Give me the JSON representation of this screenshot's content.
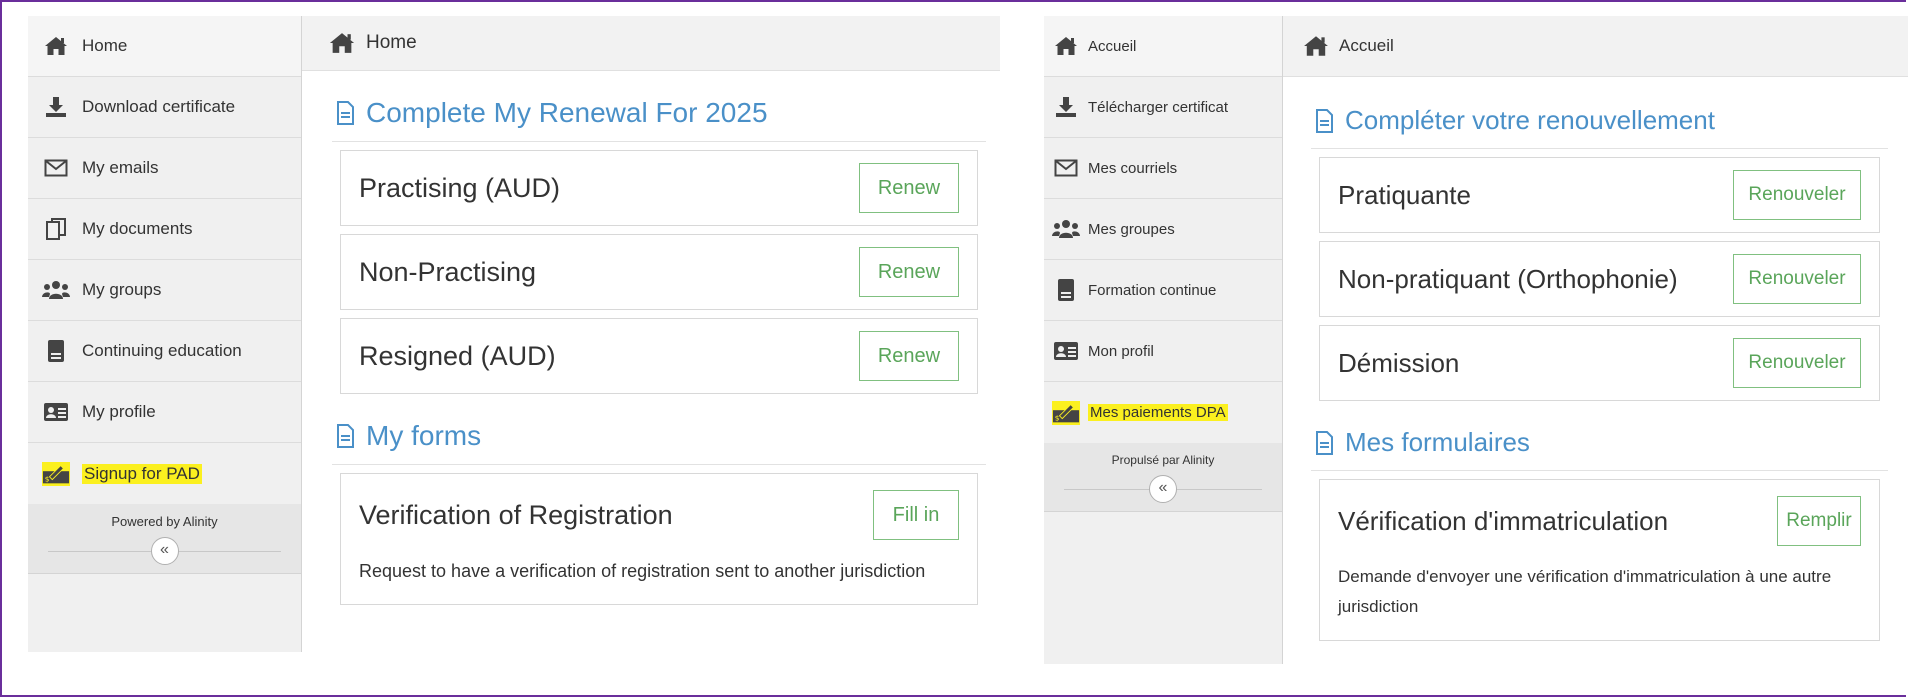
{
  "en": {
    "sidebar": {
      "items": [
        {
          "label": "Home",
          "icon": "home-icon"
        },
        {
          "label": "Download certificate",
          "icon": "download-icon"
        },
        {
          "label": "My emails",
          "icon": "envelope-icon"
        },
        {
          "label": "My documents",
          "icon": "documents-icon"
        },
        {
          "label": "My groups",
          "icon": "groups-icon"
        },
        {
          "label": "Continuing education",
          "icon": "book-icon"
        },
        {
          "label": "My profile",
          "icon": "id-card-icon"
        },
        {
          "label": "Signup for PAD",
          "icon": "check-payment-icon"
        }
      ],
      "powered_by": "Powered by Alinity",
      "collapse_glyph": "«"
    },
    "topbar": {
      "label": "Home"
    },
    "renewal": {
      "title": "Complete My Renewal For 2025",
      "options": [
        {
          "label": "Practising (AUD)",
          "button": "Renew"
        },
        {
          "label": "Non-Practising",
          "button": "Renew"
        },
        {
          "label": "Resigned (AUD)",
          "button": "Renew"
        }
      ]
    },
    "forms": {
      "title": "My forms",
      "items": [
        {
          "label": "Verification of Registration",
          "button": "Fill in",
          "description": "Request to have a verification of registration sent to another jurisdiction"
        }
      ]
    }
  },
  "fr": {
    "sidebar": {
      "items": [
        {
          "label": "Accueil",
          "icon": "home-icon"
        },
        {
          "label": "Télécharger certificat",
          "icon": "download-icon"
        },
        {
          "label": "Mes courriels",
          "icon": "envelope-icon"
        },
        {
          "label": "Mes groupes",
          "icon": "groups-icon"
        },
        {
          "label": "Formation continue",
          "icon": "book-icon"
        },
        {
          "label": "Mon profil",
          "icon": "id-card-icon"
        },
        {
          "label": "Mes paiements DPA",
          "icon": "check-payment-icon"
        }
      ],
      "powered_by": "Propulsé par Alinity",
      "collapse_glyph": "«"
    },
    "topbar": {
      "label": "Accueil"
    },
    "renewal": {
      "title": "Compléter votre renouvellement",
      "options": [
        {
          "label": "Pratiquante",
          "button": "Renouveler"
        },
        {
          "label": "Non-pratiquant (Orthophonie)",
          "button": "Renouveler"
        },
        {
          "label": "Démission",
          "button": "Renouveler"
        }
      ]
    },
    "forms": {
      "title": "Mes formulaires",
      "items": [
        {
          "label": "Vérification d'immatriculation",
          "button": "Remplir",
          "description": "Demande d'envoyer une vérification d'immatriculation à une autre jurisdiction"
        }
      ]
    }
  },
  "colors": {
    "accent": "#4a90c8",
    "button_green": "#5aa55a",
    "highlight": "#fbf01f",
    "frame": "#6a2e9b"
  }
}
